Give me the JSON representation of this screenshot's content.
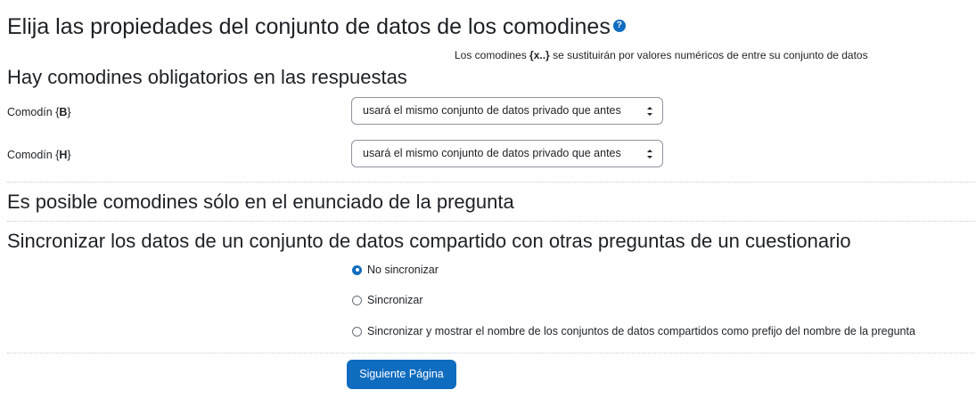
{
  "title": "Elija las propiedades del conjunto de datos de los comodines",
  "help_icon": "question-circle-icon",
  "note": {
    "prefix": "Los comodines ",
    "bold": "{x..}",
    "suffix": " se sustituirán por valores numéricos de entre su conjunto de datos"
  },
  "section_mandatory": "Hay comodines obligatorios en las respuestas",
  "wildcards": [
    {
      "label_prefix": "Comodín {",
      "name": "B",
      "label_suffix": "}",
      "selected": "usará el mismo conjunto de datos privado que antes"
    },
    {
      "label_prefix": "Comodín {",
      "name": "H",
      "label_suffix": "}",
      "selected": "usará el mismo conjunto de datos privado que antes"
    }
  ],
  "section_possible": "Es posible comodines sólo en el enunciado de la pregunta",
  "section_sync": "Sincronizar los datos de un conjunto de datos compartido con otras preguntas de un cuestionario",
  "sync_options": [
    {
      "label": "No sincronizar",
      "checked": true
    },
    {
      "label": "Sincronizar",
      "checked": false
    },
    {
      "label": "Sincronizar y mostrar el nombre de los conjuntos de datos compartidos como prefijo del nombre de la pregunta",
      "checked": false
    }
  ],
  "next_button": "Siguiente Página",
  "colors": {
    "accent": "#0f6cbf",
    "text": "#1d2125"
  }
}
